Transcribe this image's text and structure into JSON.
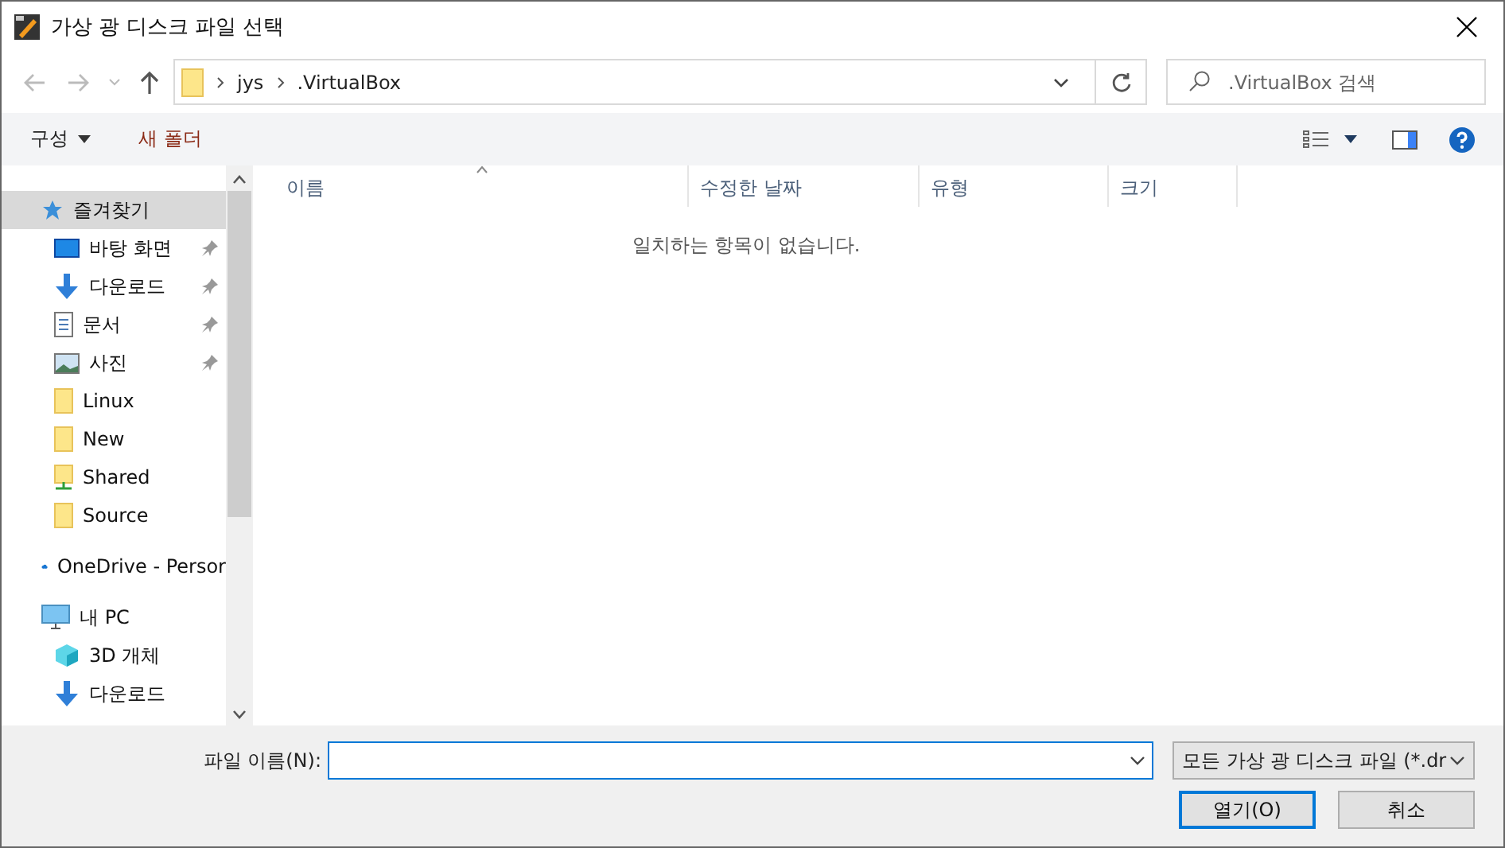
{
  "window": {
    "title": "가상 광 디스크 파일 선택"
  },
  "address": {
    "breadcrumbs": [
      "jys",
      ".VirtualBox"
    ]
  },
  "search": {
    "placeholder": ".VirtualBox 검색"
  },
  "toolbar": {
    "organize": "구성",
    "new_folder": "새 폴더"
  },
  "sidebar": {
    "items": [
      {
        "label": "즐겨찾기",
        "kind": "favorites",
        "selected": true,
        "children": [
          {
            "label": "바탕 화면",
            "kind": "desktop",
            "pinned": true,
            "selected": false
          },
          {
            "label": "다운로드",
            "kind": "download",
            "pinned": true,
            "selected": false
          },
          {
            "label": "문서",
            "kind": "document",
            "pinned": true,
            "selected": false
          },
          {
            "label": "사진",
            "kind": "picture",
            "pinned": true,
            "selected": false
          },
          {
            "label": "Linux",
            "kind": "folder",
            "pinned": false,
            "selected": false
          },
          {
            "label": "New",
            "kind": "folder",
            "pinned": false,
            "selected": false
          },
          {
            "label": "Shared",
            "kind": "shared",
            "pinned": false,
            "selected": false
          },
          {
            "label": "Source",
            "kind": "folder",
            "pinned": false,
            "selected": false
          }
        ]
      },
      {
        "label": "OneDrive - Persor",
        "kind": "cloud",
        "selected": false
      },
      {
        "label": "내 PC",
        "kind": "pc",
        "selected": false,
        "children": [
          {
            "label": "3D 개체",
            "kind": "cube",
            "pinned": false,
            "selected": false
          },
          {
            "label": "다운로드",
            "kind": "download",
            "pinned": false,
            "selected": false
          }
        ]
      }
    ]
  },
  "table": {
    "columns": [
      "이름",
      "수정한 날짜",
      "유형",
      "크기"
    ],
    "empty_message": "일치하는 항목이 없습니다."
  },
  "footer": {
    "file_name_label": "파일 이름(N):",
    "file_type": "모든 가상 광 디스크 파일 (*.dr",
    "buttons": [
      "열기(O)",
      "취소"
    ]
  }
}
